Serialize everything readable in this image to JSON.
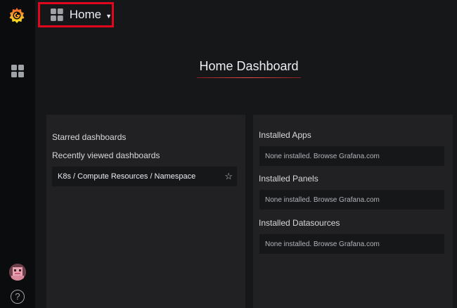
{
  "navbar": {
    "home_label": "Home"
  },
  "page": {
    "title": "Home Dashboard"
  },
  "left_panel": {
    "starred_heading": "Starred dashboards",
    "recent_heading": "Recently viewed dashboards",
    "recent_items": [
      {
        "label": "K8s / Compute Resources / Namespace"
      }
    ]
  },
  "right_panel": {
    "apps_heading": "Installed Apps",
    "apps_empty": "None installed. Browse Grafana.com",
    "panels_heading": "Installed Panels",
    "panels_empty": "None installed. Browse Grafana.com",
    "datasources_heading": "Installed Datasources",
    "datasources_empty": "None installed. Browse Grafana.com"
  },
  "sidebar": {
    "help_glyph": "?"
  },
  "icons": [
    "grafana-logo-icon",
    "dashboards-icon",
    "avatar",
    "help-icon",
    "grid-icon",
    "caret-down-icon",
    "star-icon"
  ],
  "colors": {
    "accent": "#e0061e",
    "brand_orange": "#f46800",
    "background": "#161719",
    "panel": "#212124"
  }
}
